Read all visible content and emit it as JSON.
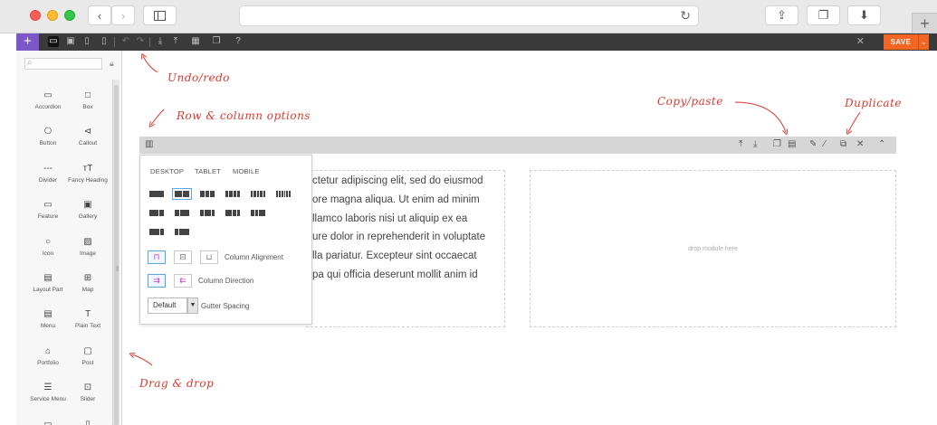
{
  "browser": {
    "back_glyph": "‹",
    "forward_glyph": "›",
    "sidebar_toggle_icon": "sidebar-icon",
    "reload_glyph": "↻",
    "share_glyph": "⇪",
    "tabs_glyph": "❐",
    "download_glyph": "⬇",
    "newtab_glyph": "+"
  },
  "toolbar": {
    "add_glyph": "+",
    "help_glyph": "?",
    "close_glyph": "✕",
    "save_label": "SAVE",
    "save_arrow": "⌄",
    "icons": [
      "desktop-icon",
      "tablet-landscape-icon",
      "tablet-portrait-icon",
      "mobile-icon",
      "undo-icon",
      "redo-icon",
      "import-icon",
      "export-icon",
      "layouts-icon",
      "duplicate-icon",
      "help-icon"
    ]
  },
  "sidebar": {
    "search_placeholder": "",
    "modules": [
      {
        "label": "Accordion",
        "glyph": "▭"
      },
      {
        "label": "Box",
        "glyph": "□"
      },
      {
        "label": "Button",
        "glyph": "⎔"
      },
      {
        "label": "Callout",
        "glyph": "⊲"
      },
      {
        "label": "Divider",
        "glyph": "---"
      },
      {
        "label": "Fancy Heading",
        "glyph": "тT"
      },
      {
        "label": "Feature",
        "glyph": "▭"
      },
      {
        "label": "Gallery",
        "glyph": "▣"
      },
      {
        "label": "Icon",
        "glyph": "○"
      },
      {
        "label": "Image",
        "glyph": "▨"
      },
      {
        "label": "Layout Part",
        "glyph": "▤"
      },
      {
        "label": "Map",
        "glyph": "⊞"
      },
      {
        "label": "Menu",
        "glyph": "▤"
      },
      {
        "label": "Plain Text",
        "glyph": "T"
      },
      {
        "label": "Portfolio",
        "glyph": "⌂"
      },
      {
        "label": "Post",
        "glyph": "▢"
      },
      {
        "label": "Service Menu",
        "glyph": "☰"
      },
      {
        "label": "Slider",
        "glyph": "⊡"
      },
      {
        "label": "",
        "glyph": "▭"
      },
      {
        "label": "",
        "glyph": "▯"
      }
    ]
  },
  "canvas": {
    "lorem_lines": [
      "ctetur adipiscing elit, sed do eiusmod",
      "ore magna aliqua. Ut enim ad minim",
      "llamco laboris nisi ut aliquip ex ea",
      "ure dolor in reprehenderit in voluptate",
      "lla pariatur. Excepteur sint occaecat",
      "pa qui officia deserunt mollit anim id"
    ],
    "drop_text": "drop module here",
    "row_tools": [
      "export-icon",
      "import-icon",
      "copy-icon",
      "paste-icon",
      "edit-icon",
      "style-icon",
      "duplicate-icon",
      "delete-icon",
      "collapse-icon"
    ]
  },
  "row_options": {
    "tabs": [
      "DESKTOP",
      "TABLET",
      "MOBILE"
    ],
    "grid_layouts": [
      [
        1
      ],
      [
        1,
        1
      ],
      [
        1,
        1,
        1
      ],
      [
        1,
        1,
        1,
        1
      ],
      [
        1,
        1,
        1,
        1,
        1
      ],
      [
        1,
        1,
        1,
        1,
        1,
        1
      ],
      [
        2,
        1
      ],
      [
        1,
        2
      ],
      [
        1,
        2,
        1
      ],
      [
        2,
        1,
        1
      ],
      [
        1,
        1,
        2
      ],
      [
        3,
        1
      ],
      [
        1,
        3
      ]
    ],
    "column_alignment_label": "Column Alignment",
    "column_direction_label": "Column Direction",
    "gutter_value": "Default",
    "gutter_label": "Gutter Spacing"
  },
  "annotations": {
    "undo_redo": "Undo/redo",
    "row_column_options": "Row & column options",
    "copy_paste": "Copy/paste",
    "duplicate": "Duplicate",
    "drag_drop": "Drag & drop"
  },
  "colors": {
    "accent_purple": "#7b57c7",
    "save_orange": "#f26522",
    "annotation_red": "#d63a2f",
    "selection_blue": "#5aa7e8"
  }
}
